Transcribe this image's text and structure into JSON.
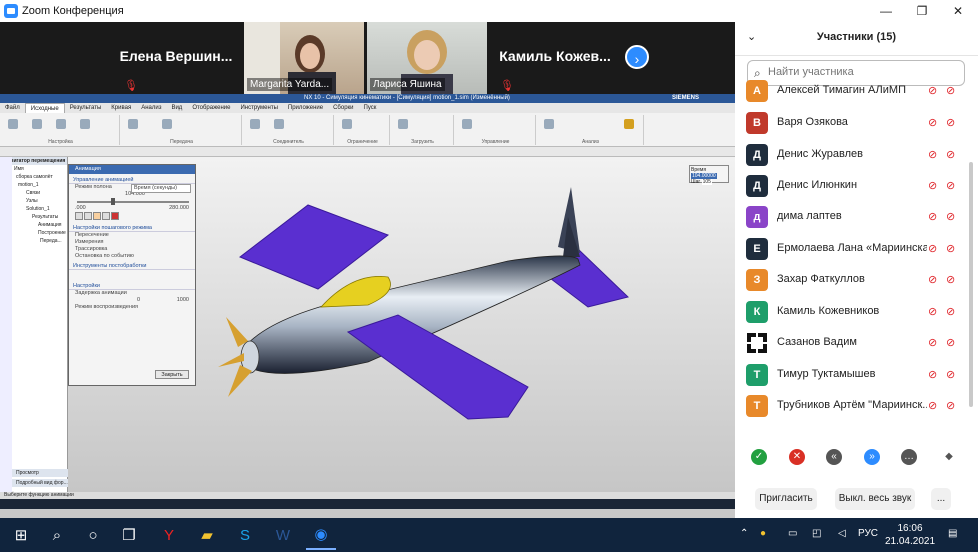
{
  "window": {
    "title": "Zoom Конференция"
  },
  "video_strip": {
    "names": [
      "Елена Вершин...",
      "Камиль Кожев..."
    ],
    "videos": [
      {
        "caption": "Margarita Yarda..."
      },
      {
        "caption": "Лариса Яшина"
      }
    ]
  },
  "share": {
    "nx_title": "NX 10 - Симуляция кинематики - [Симуляция] motion_1.sim (Изменённый)",
    "nx_brand": "SIEMENS",
    "menu": [
      "Файл",
      "Исходные",
      "Результаты",
      "Кривая",
      "Анализ",
      "Вид",
      "Отображение",
      "Инструменты",
      "Приложение",
      "Сборки",
      "Пуск"
    ],
    "ribbon_groups": [
      "Настройка",
      "Передача",
      "Соединитель",
      "Ограничение",
      "Загрузить",
      "Управление",
      "Анализ"
    ],
    "nav_title": "Навигатор перемещения",
    "nav_rows": [
      "Имя",
      "сборка самолёт",
      "motion_1",
      "Связи",
      "Узлы",
      "Solution_1",
      "Результаты",
      "Анимация",
      "Построение",
      "Переда..."
    ],
    "nav_bottom": [
      "Просмотр",
      "Подробный вид фор..."
    ],
    "dialog": {
      "title": "Анимация",
      "sec_control": "Управление анимацией",
      "mode_label": "Режим полона",
      "mode_value": "Время (секунды)",
      "time_value": "104.000",
      "time_min": ".000",
      "time_max": "280.000",
      "sec_step": "Настройки пошагового режима",
      "checks": [
        "Пересечение",
        "Измерения",
        "Трассировка",
        "Остановка по событию"
      ],
      "sec_post": "Инструменты постобработки",
      "sec_settings": "Настройки",
      "delay_label": "Задержка анимации",
      "delay_min": "0",
      "delay_max": "1000",
      "playback_label": "Режим воспроизведения",
      "close_label": "Закрыть"
    },
    "timebox": {
      "time_label": "Время",
      "time_value": "104.00000",
      "step_label": "Шаг",
      "step_value": "105"
    },
    "status": "Выберите функцию анимации"
  },
  "participants": {
    "title": "Участники (15)",
    "search_placeholder": "Найти участника",
    "list": [
      {
        "initial": "А",
        "name": "Алексей Тимагин АЛиМП",
        "color": "#e8892a"
      },
      {
        "initial": "В",
        "name": "Варя Озякова",
        "color": "#c0392b"
      },
      {
        "initial": "Д",
        "name": "Денис Журавлев",
        "color": "#1f2d3d"
      },
      {
        "initial": "Д",
        "name": "Денис Илюнкин",
        "color": "#1f2d3d"
      },
      {
        "initial": "д",
        "name": "дима лаптев",
        "color": "#8a44c8"
      },
      {
        "initial": "Е",
        "name": "Ермолаева Лана «Мариинская...",
        "color": "#1f2d3d"
      },
      {
        "initial": "З",
        "name": "Захар Фаткуллов",
        "color": "#e8892a"
      },
      {
        "initial": "К",
        "name": "Камиль Кожевников",
        "color": "#1e9e6a"
      },
      {
        "initial": "",
        "name": "Сазанов Вадим",
        "color": "#ffffff"
      },
      {
        "initial": "Т",
        "name": "Тимур Туктамышев",
        "color": "#1e9e6a"
      },
      {
        "initial": "Т",
        "name": "Трубников Артём \"Мариинск...",
        "color": "#e8892a"
      }
    ],
    "invite_label": "Пригласить",
    "mute_all_label": "Выкл. весь звук",
    "more_label": "..."
  },
  "taskbar": {
    "language": "РУС",
    "time": "16:06",
    "date": "21.04.2021"
  }
}
